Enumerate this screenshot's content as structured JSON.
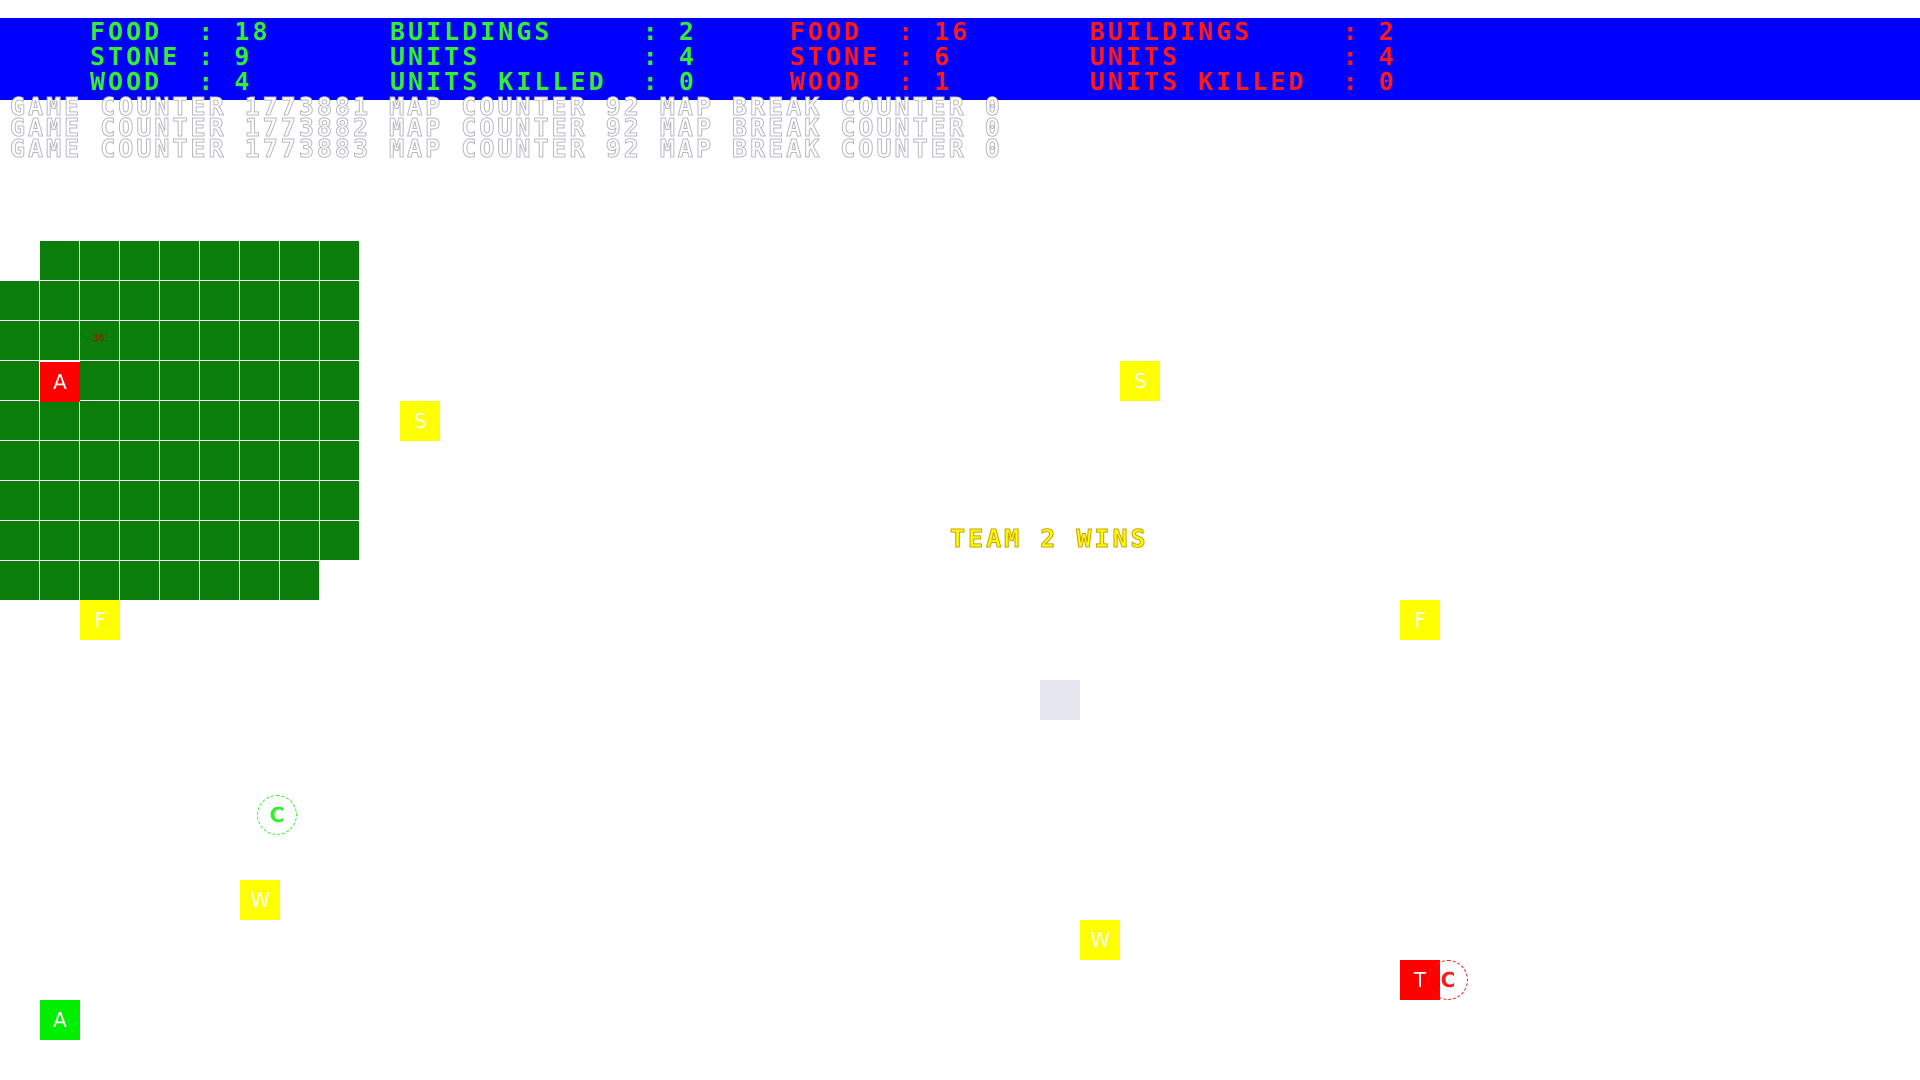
{
  "team1": {
    "color": "#33ee33",
    "food_line": "FOOD  : 18",
    "stone_line": "STONE : 9",
    "wood_line": "WOOD  : 4",
    "buildings_line": "BUILDINGS     : 2",
    "units_line": "UNITS         : 4",
    "killed_line": "UNITS KILLED  : 0"
  },
  "team2": {
    "color": "#ff1a1a",
    "food_line": "FOOD  : 16",
    "stone_line": "STONE : 6",
    "wood_line": "WOOD  : 1",
    "buildings_line": "BUILDINGS     : 2",
    "units_line": "UNITS         : 4",
    "killed_line": "UNITS KILLED  : 0"
  },
  "debug": [
    "GAME COUNTER 1773881 MAP COUNTER 92 MAP BREAK COUNTER 0",
    "GAME COUNTER 1773882 MAP COUNTER 92 MAP BREAK COUNTER 0",
    "GAME COUNTER 1773883 MAP COUNTER 92 MAP BREAK COUNTER 0"
  ],
  "map": {
    "resources": [
      {
        "label": "S",
        "name": "stone-resource"
      },
      {
        "label": "S",
        "name": "stone-resource"
      },
      {
        "label": "F",
        "name": "food-resource"
      },
      {
        "label": "F",
        "name": "food-resource"
      },
      {
        "label": "W",
        "name": "wood-resource"
      },
      {
        "label": "W",
        "name": "wood-resource"
      }
    ],
    "team1_archery": "A",
    "team1_unit": "A",
    "team1_collector": "C",
    "team2_archery": "A",
    "team2_town_center": "T",
    "team2_collector": "C",
    "marker": "36"
  },
  "win_message": "TEAM 2 WINS"
}
